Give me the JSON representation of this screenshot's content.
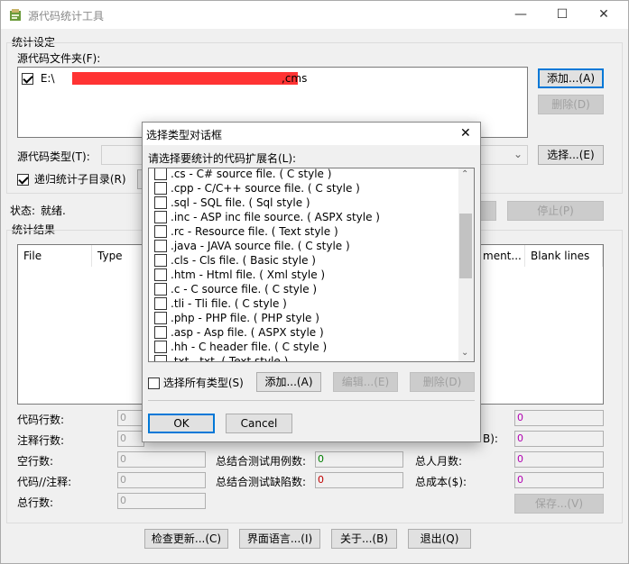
{
  "window": {
    "title": "源代码统计工具",
    "controls": {
      "minimize": "—",
      "maximize": "☐",
      "close": "✕"
    }
  },
  "settings": {
    "group_title": "统计设定",
    "folder_label": "源代码文件夹(F):",
    "folder_prefix": "E:\\",
    "folder_suffix": ",cms",
    "folder_checked": true,
    "add_button": "添加...(A)",
    "delete_button": "删除(D)",
    "type_label": "源代码类型(T):",
    "select_button": "选择...(E)",
    "recursive_label": "递归统计子目录(R)",
    "recursive_checked": true
  },
  "status": {
    "label": "状态:",
    "value": "就绪.",
    "stop_button": "停止(P)"
  },
  "results": {
    "group_title": "统计结果",
    "columns": [
      "File",
      "Type",
      "ment...",
      "Blank lines"
    ]
  },
  "stats": {
    "code_lines_label": "代码行数:",
    "comment_lines_label": "注释行数:",
    "blank_lines_label": "空行数:",
    "code_comment_label": "代码//注释:",
    "total_lines_label": "总行数:",
    "code_lines": "0",
    "comment_lines": "0",
    "blank_lines": "0",
    "code_comment": "0",
    "total_lines": "0",
    "test_cases_label": "总结合测试用例数:",
    "test_cases": "0",
    "test_defects_label": "总结合测试缺陷数:",
    "test_defects": "0",
    "partial_label_right": "B):",
    "person_month_label": "总人月数:",
    "person_month": "0",
    "total_cost_label": "总成本($):",
    "total_cost": "0",
    "right_top_value": "0",
    "right_second_value": "0",
    "save_button": "保存...(V)"
  },
  "bottom_buttons": {
    "update": "检查更新...(C)",
    "language": "界面语言...(I)",
    "about": "关于...(B)",
    "exit": "退出(Q)"
  },
  "dialog": {
    "title": "选择类型对话框",
    "close": "✕",
    "prompt": "请选择要统计的代码扩展名(L):",
    "items": [
      ".cs - C# source file. ( C style )",
      ".cpp - C/C++ source file. ( C style )",
      ".sql - SQL file. ( Sql style )",
      ".inc - ASP inc file source. ( ASPX style )",
      ".rc - Resource file. ( Text style )",
      ".java - JAVA source file. ( C style )",
      ".cls - Cls file. ( Basic style )",
      ".htm - Html file. ( Xml style )",
      ".c - C source file. ( C style )",
      ".tli - Tli file. ( C style )",
      ".php - PHP file. ( PHP style )",
      ".asp - Asp file. ( ASPX style )",
      ".hh - C header file. ( C style )",
      ".txt - txt. ( Text style )"
    ],
    "select_all_label": "选择所有类型(S)",
    "add_button": "添加...(A)",
    "edit_button": "编辑...(E)",
    "delete_button": "删除(D)",
    "ok_button": "OK",
    "cancel_button": "Cancel"
  },
  "colors": {
    "redaction": "#ff3333",
    "accent": "#0078d7",
    "value_green": "#008000",
    "value_red": "#c00000",
    "value_magenta": "#b000b0"
  }
}
